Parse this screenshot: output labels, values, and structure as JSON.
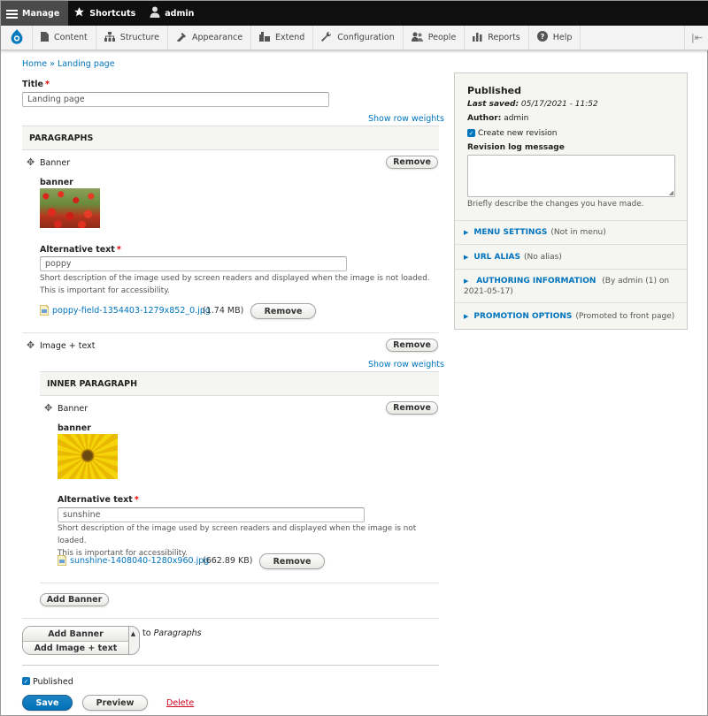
{
  "toolbar": {
    "manage": "Manage",
    "shortcuts": "Shortcuts",
    "user": "admin"
  },
  "tray": {
    "items": [
      {
        "label": "Content",
        "icon": "content-icon"
      },
      {
        "label": "Structure",
        "icon": "structure-icon"
      },
      {
        "label": "Appearance",
        "icon": "appearance-icon"
      },
      {
        "label": "Extend",
        "icon": "extend-icon"
      },
      {
        "label": "Configuration",
        "icon": "configuration-icon"
      },
      {
        "label": "People",
        "icon": "people-icon"
      },
      {
        "label": "Reports",
        "icon": "reports-icon"
      },
      {
        "label": "Help",
        "icon": "help-icon"
      }
    ]
  },
  "breadcrumb": {
    "home": "Home",
    "separator": "»",
    "current": "Landing page"
  },
  "title_field": {
    "label": "Title",
    "required": "*",
    "value": "Landing page"
  },
  "show_row_weights": "Show row weights",
  "paragraphs": {
    "header": "PARAGRAPHS",
    "banner": {
      "type": "Banner",
      "remove": "Remove",
      "subtitle": "banner",
      "alt_label": "Alternative text",
      "required": "*",
      "alt_value": "poppy",
      "alt_desc": "Short description of the image used by screen readers and displayed when the image is not loaded. This is important for accessibility.",
      "file_name": "poppy-field-1354403-1279x852_0.jpg",
      "file_size": "(1.74 MB)",
      "file_remove": "Remove"
    },
    "image_text": {
      "type": "Image + text",
      "remove": "Remove",
      "show_row_weights": "Show row weights",
      "inner_header": "INNER PARAGRAPH",
      "inner_banner": {
        "type": "Banner",
        "remove": "Remove",
        "subtitle": "banner",
        "alt_label": "Alternative text",
        "required": "*",
        "alt_value": "sunshine",
        "alt_desc_line1": "Short description of the image used by screen readers and displayed when the image is not loaded.",
        "alt_desc_line2": "This is important for accessibility.",
        "file_name": "sunshine-1408040-1280x960.jpg",
        "file_size": "(662.89 KB)",
        "file_remove": "Remove"
      },
      "add_banner": "Add Banner"
    },
    "add_dropdown": {
      "first": "Add Banner",
      "second": "Add Image + text",
      "to": "to",
      "target": "Paragraphs"
    }
  },
  "published_checkbox": "Published",
  "actions": {
    "save": "Save",
    "preview": "Preview",
    "delete": "Delete"
  },
  "sidebar": {
    "status": "Published",
    "last_saved_label": "Last saved:",
    "last_saved_value": "05/17/2021 - 11:52",
    "author_label": "Author:",
    "author_value": "admin",
    "create_revision": "Create new revision",
    "revision_log_label": "Revision log message",
    "revision_desc": "Briefly describe the changes you have made.",
    "sections": [
      {
        "title": "MENU SETTINGS",
        "summary": "(Not in menu)"
      },
      {
        "title": "URL ALIAS",
        "summary": "(No alias)"
      },
      {
        "title": "AUTHORING INFORMATION",
        "summary": "(By admin (1) on",
        "summary2": "2021-05-17)"
      },
      {
        "title": "PROMOTION OPTIONS",
        "summary": "(Promoted to front page)"
      }
    ]
  },
  "colors": {
    "link": "#0074bd",
    "primary": "#0071b8",
    "toolbar": "#0f0f0f",
    "delete": "#d0021b",
    "required": "#e00000"
  }
}
